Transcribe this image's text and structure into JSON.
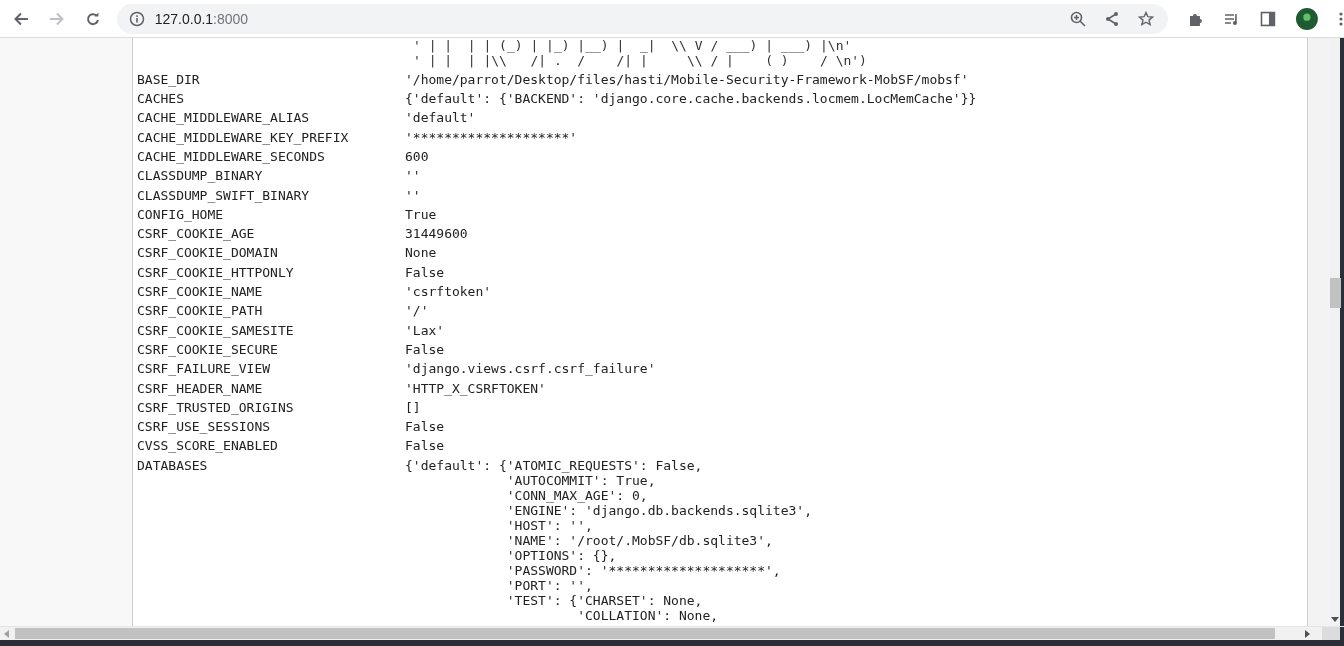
{
  "browser": {
    "url_host": "127.0.0.1",
    "url_port": ":8000"
  },
  "settings": {
    "art_lines": [
      "' | |  | | (_) | |_) |__) |  _|  \\\\ V / ___) | ___) |\\n'",
      "' | |  | |\\\\   /| .  /    /| |     \\\\ / |    ( )    / \\n')"
    ],
    "rows": [
      {
        "key": "BASE_DIR",
        "value_lines": [
          "'/home/parrot/Desktop/files/hasti/Mobile-Security-Framework-MobSF/mobsf'"
        ]
      },
      {
        "key": "CACHES",
        "value_lines": [
          "{'default': {'BACKEND': 'django.core.cache.backends.locmem.LocMemCache'}}"
        ]
      },
      {
        "key": "CACHE_MIDDLEWARE_ALIAS",
        "value_lines": [
          "'default'"
        ]
      },
      {
        "key": "CACHE_MIDDLEWARE_KEY_PREFIX",
        "value_lines": [
          "'********************'"
        ]
      },
      {
        "key": "CACHE_MIDDLEWARE_SECONDS",
        "value_lines": [
          "600"
        ]
      },
      {
        "key": "CLASSDUMP_BINARY",
        "value_lines": [
          "''"
        ]
      },
      {
        "key": "CLASSDUMP_SWIFT_BINARY",
        "value_lines": [
          "''"
        ]
      },
      {
        "key": "CONFIG_HOME",
        "value_lines": [
          "True"
        ]
      },
      {
        "key": "CSRF_COOKIE_AGE",
        "value_lines": [
          "31449600"
        ]
      },
      {
        "key": "CSRF_COOKIE_DOMAIN",
        "value_lines": [
          "None"
        ]
      },
      {
        "key": "CSRF_COOKIE_HTTPONLY",
        "value_lines": [
          "False"
        ]
      },
      {
        "key": "CSRF_COOKIE_NAME",
        "value_lines": [
          "'csrftoken'"
        ]
      },
      {
        "key": "CSRF_COOKIE_PATH",
        "value_lines": [
          "'/'"
        ]
      },
      {
        "key": "CSRF_COOKIE_SAMESITE",
        "value_lines": [
          "'Lax'"
        ]
      },
      {
        "key": "CSRF_COOKIE_SECURE",
        "value_lines": [
          "False"
        ]
      },
      {
        "key": "CSRF_FAILURE_VIEW",
        "value_lines": [
          "'django.views.csrf.csrf_failure'"
        ]
      },
      {
        "key": "CSRF_HEADER_NAME",
        "value_lines": [
          "'HTTP_X_CSRFTOKEN'"
        ]
      },
      {
        "key": "CSRF_TRUSTED_ORIGINS",
        "value_lines": [
          "[]"
        ]
      },
      {
        "key": "CSRF_USE_SESSIONS",
        "value_lines": [
          "False"
        ]
      },
      {
        "key": "CVSS_SCORE_ENABLED",
        "value_lines": [
          "False"
        ]
      },
      {
        "key": "DATABASES",
        "value_lines": [
          "{'default': {'ATOMIC_REQUESTS': False,",
          "             'AUTOCOMMIT': True,",
          "             'CONN_MAX_AGE': 0,",
          "             'ENGINE': 'django.db.backends.sqlite3',",
          "             'HOST': '',",
          "             'NAME': '/root/.MobSF/db.sqlite3',",
          "             'OPTIONS': {},",
          "             'PASSWORD': '********************',",
          "             'PORT': '',",
          "             'TEST': {'CHARSET': None,",
          "                      'COLLATION': None,"
        ]
      }
    ]
  }
}
